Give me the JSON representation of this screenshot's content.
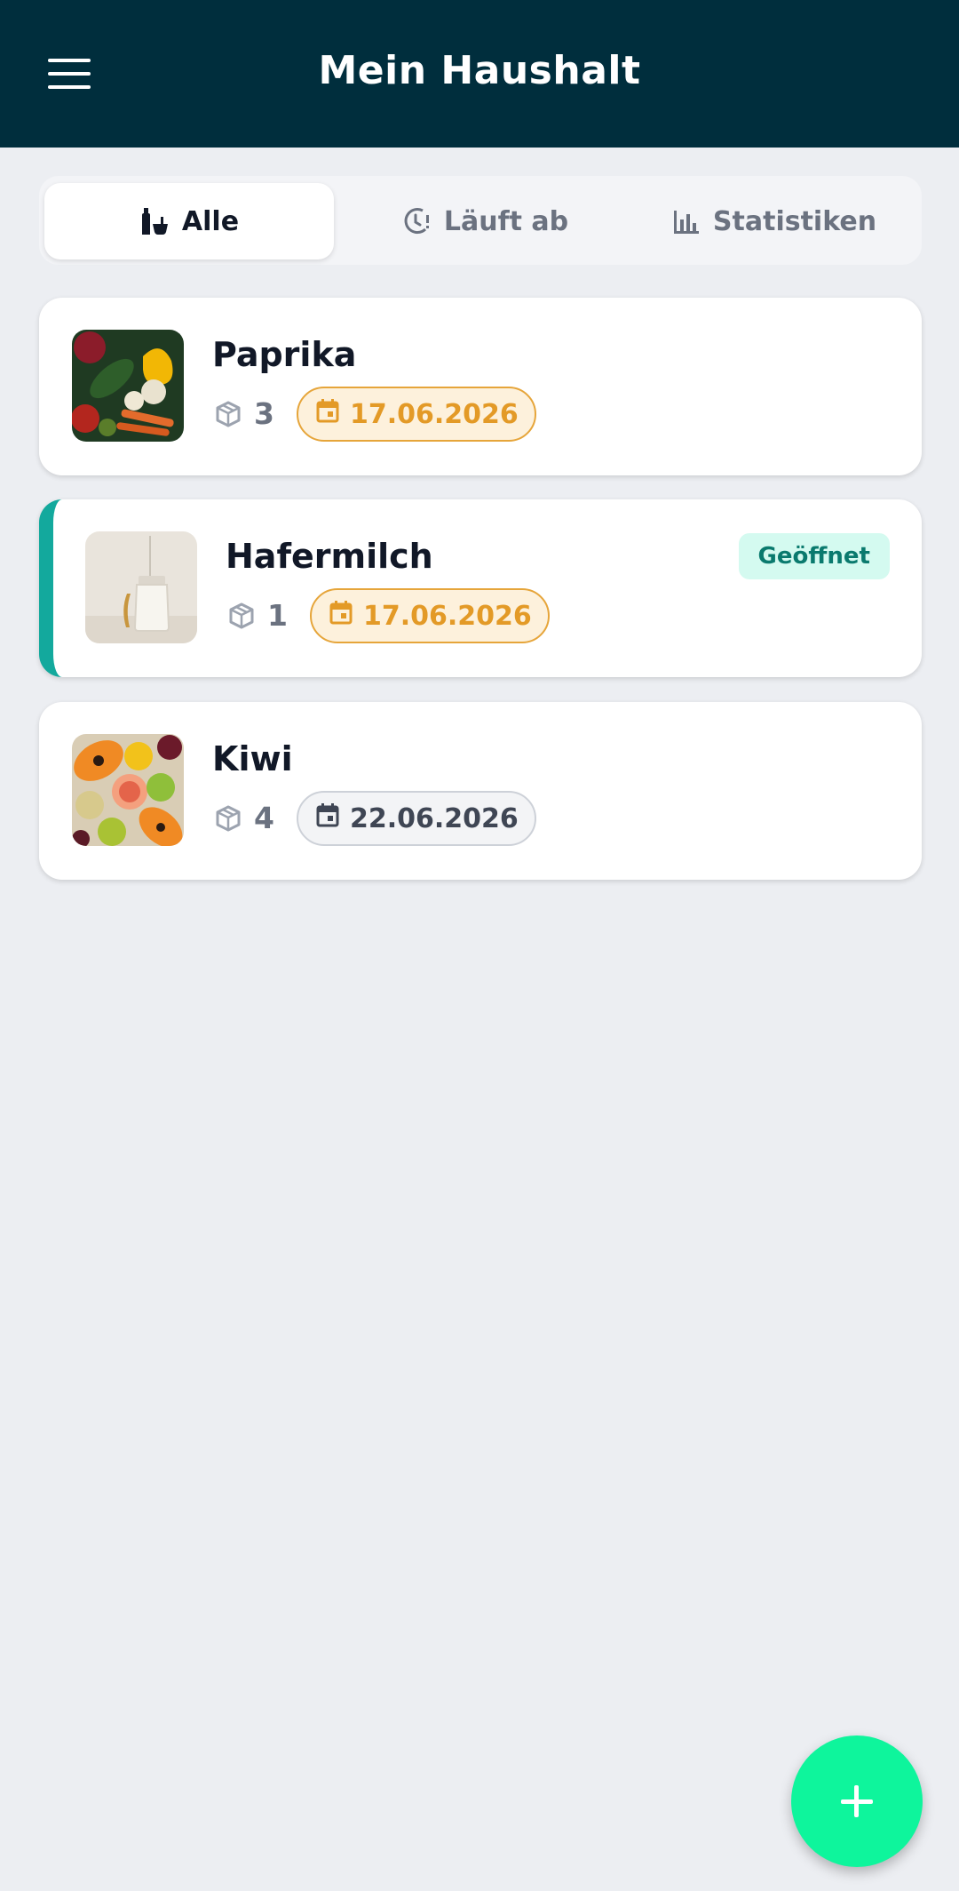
{
  "header": {
    "title": "Mein Haushalt",
    "menu_icon": "hamburger-menu-icon"
  },
  "tabs": [
    {
      "label": "Alle",
      "icon": "bottles-icon",
      "active": true
    },
    {
      "label": "Läuft ab",
      "icon": "clock-alert-icon",
      "active": false
    },
    {
      "label": "Statistiken",
      "icon": "bar-chart-icon",
      "active": false
    }
  ],
  "items": [
    {
      "name": "Paprika",
      "quantity": "3",
      "date": "17.06.2026",
      "date_status": "warn",
      "opened": false,
      "badge": ""
    },
    {
      "name": "Hafermilch",
      "quantity": "1",
      "date": "17.06.2026",
      "date_status": "warn",
      "opened": true,
      "badge": "Geöffnet"
    },
    {
      "name": "Kiwi",
      "quantity": "4",
      "date": "22.06.2026",
      "date_status": "ok",
      "opened": false,
      "badge": ""
    }
  ],
  "fab": {
    "icon": "plus-icon"
  },
  "colors": {
    "appbar": "#002e3d",
    "accent": "#0ef59c",
    "opened_border": "#13a99d",
    "warn": "#e39a27"
  }
}
